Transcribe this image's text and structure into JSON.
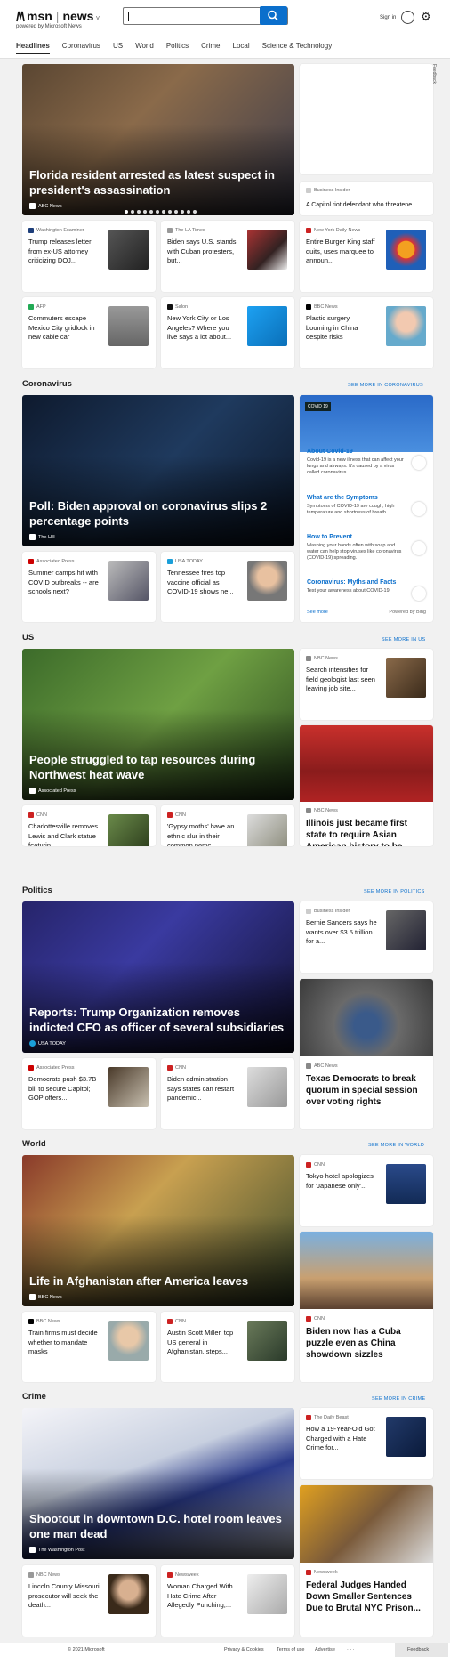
{
  "header": {
    "brand": "msn",
    "section": "news",
    "powered_by": "powered by Microsoft News",
    "signin": "Sign in",
    "feedback_tab": "Feedback"
  },
  "nav": [
    "Headlines",
    "Coronavirus",
    "US",
    "World",
    "Politics",
    "Crime",
    "Local",
    "Science & Technology"
  ],
  "top": {
    "hero": {
      "title": "Florida resident arrested as latest suspect in president's assassination",
      "source": "ABC News"
    },
    "side": {
      "source": "Business Insider",
      "title": "A Capitol riot defendant who threatene..."
    },
    "cards": [
      {
        "source": "Washington Examiner",
        "title": "Trump releases letter from ex-US attorney criticizing DOJ..."
      },
      {
        "source": "The LA Times",
        "title": "Biden says U.S. stands with Cuban protesters, but..."
      },
      {
        "source": "New York Daily News",
        "title": "Entire Burger King staff quits, uses marquee to announ..."
      },
      {
        "source": "AFP",
        "title": "Commuters escape Mexico City gridlock in new cable car"
      },
      {
        "source": "Salon",
        "title": "New York City or Los Angeles? Where you live says a lot about..."
      },
      {
        "source": "BBC News",
        "title": "Plastic surgery booming in China despite risks"
      }
    ]
  },
  "coronavirus": {
    "heading": "Coronavirus",
    "more": "SEE MORE IN CORONAVIRUS",
    "hero": {
      "title": "Poll: Biden approval on coronavirus slips 2 percentage points",
      "source": "The Hill"
    },
    "cards": [
      {
        "source": "Associated Press",
        "title": "Summer camps hit with COVID outbreaks -- are schools next?"
      },
      {
        "source": "USA TODAY",
        "title": "Tennessee fires top vaccine official as COVID-19 shows ne..."
      }
    ],
    "info": {
      "badge": "COVID 19",
      "items": [
        {
          "title": "About Covid-19",
          "text": "Covid-19 is a new illness that can affect your lungs and airways. It's caused by a virus called coronavirus."
        },
        {
          "title": "What are the Symptoms",
          "text": "Symptoms of COVID-19 are cough, high temperature and shortness of breath."
        },
        {
          "title": "How to Prevent",
          "text": "Washing your hands often with soap and water can help stop viruses like coronavirus (COVID-19) spreading."
        },
        {
          "title": "Coronavirus: Myths and Facts",
          "text": "Test your awareness about COVID-19"
        }
      ],
      "see_more": "See more",
      "powered": "Powered by Bing"
    }
  },
  "us": {
    "heading": "US",
    "more": "SEE MORE IN US",
    "hero": {
      "title": "People struggled to tap resources during Northwest heat wave",
      "source": "Associated Press"
    },
    "side_top": {
      "source": "NBC News",
      "title": "Search intensifies for field geologist last seen leaving job site..."
    },
    "side_big": {
      "source": "NBC News",
      "title": "Illinois just became first state to require Asian American history to be taught in..."
    },
    "cards": [
      {
        "source": "CNN",
        "title": "Charlottesville removes Lewis and Clark statue featurin..."
      },
      {
        "source": "CNN",
        "title": "'Gypsy moths' have an ethnic slur in their common name...."
      }
    ]
  },
  "politics": {
    "heading": "Politics",
    "more": "SEE MORE IN POLITICS",
    "hero": {
      "title": "Reports: Trump Organization removes indicted CFO as officer of several subsidiaries",
      "source": "USA TODAY"
    },
    "side_top": {
      "source": "Business Insider",
      "title": "Bernie Sanders says he wants over $3.5 trillion for a..."
    },
    "side_big": {
      "source": "ABC News",
      "title": "Texas Democrats to break quorum in special session over voting rights"
    },
    "cards": [
      {
        "source": "Associated Press",
        "title": "Democrats push $3.7B bill to secure Capitol; GOP offers..."
      },
      {
        "source": "CNN",
        "title": "Biden administration says states can restart pandemic..."
      }
    ]
  },
  "world": {
    "heading": "World",
    "more": "SEE MORE IN WORLD",
    "hero": {
      "title": "Life in Afghanistan after America leaves",
      "source": "BBC News"
    },
    "side_top": {
      "source": "CNN",
      "title": "Tokyo hotel apologizes for 'Japanese only'..."
    },
    "side_big": {
      "source": "CNN",
      "title": "Biden now has a Cuba puzzle even as China showdown sizzles"
    },
    "cards": [
      {
        "source": "BBC News",
        "title": "Train firms must decide whether to mandate masks"
      },
      {
        "source": "CNN",
        "title": "Austin Scott Miller, top US general in Afghanistan, steps..."
      }
    ]
  },
  "crime": {
    "heading": "Crime",
    "more": "SEE MORE IN CRIME",
    "hero": {
      "title": "Shootout in downtown D.C. hotel room leaves one man dead",
      "source": "The Washington Post"
    },
    "side_top": {
      "source": "The Daily Beast",
      "title": "How a 19-Year-Old Got Charged with a Hate Crime for..."
    },
    "side_big": {
      "source": "Newsweek",
      "title": "Federal Judges Handed Down Smaller Sentences Due to Brutal NYC Prison..."
    },
    "cards": [
      {
        "source": "NBC News",
        "title": "Lincoln County Missouri prosecutor will seek the death..."
      },
      {
        "source": "Newsweek",
        "title": "Woman Charged With Hate Crime After Allegedly Punching,..."
      }
    ]
  },
  "footer": {
    "copyright": "© 2021 Microsoft",
    "privacy": "Privacy & Cookies",
    "terms": "Terms of use",
    "advertise": "Advertise",
    "more": "· · ·",
    "feedback": "Feedback"
  },
  "colors": {
    "accent": "#0b6fcc",
    "page_bg": "#f1f1f1"
  }
}
